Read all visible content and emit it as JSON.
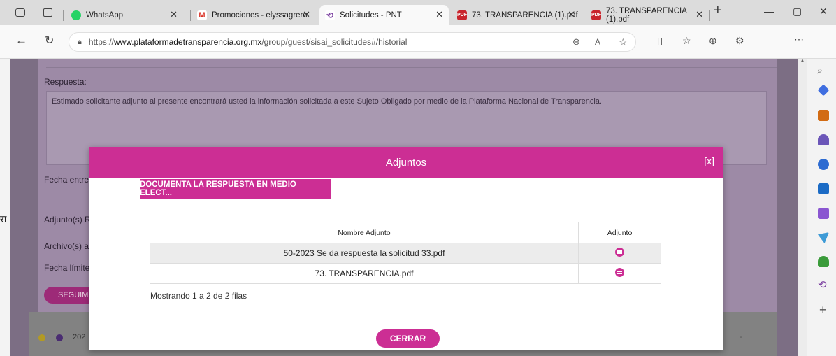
{
  "browser": {
    "tabs": [
      {
        "label": "WhatsApp"
      },
      {
        "label": "Promociones - elyssagrero"
      },
      {
        "label": "Solicitudes - PNT"
      },
      {
        "label": "73. TRANSPARENCIA (1).pdf"
      },
      {
        "label": "73. TRANSPARENCIA (1).pdf"
      }
    ],
    "url_prefix": "https://",
    "url_domain": "www.plataformadetransparencia.org.mx",
    "url_path": "/group/guest/sisai_solicitudes#/historial"
  },
  "background": {
    "respuesta_label": "Respuesta:",
    "respuesta_text": "Estimado solicitante adjunto al presente encontrará usted la información solicitada a este Sujeto Obligado por medio de la Plataforma Nacional de Transparencia.",
    "fecha_entrega_label": "Fecha entre",
    "adjuntos_label": "Adjunto(s) R",
    "archivos_label": "Archivo(s) a",
    "fecha_limite_label": "Fecha límite",
    "seguimiento_label": "SEGUIM",
    "row_year": "202"
  },
  "modal": {
    "title": "Adjuntos",
    "close": "[x]",
    "doc_button": "DOCUMENTA LA RESPUESTA EN MEDIO ELECT...",
    "table": {
      "headers": [
        "Nombre Adjunto",
        "Adjunto"
      ],
      "rows": [
        {
          "name": "50-2023 Se da respuesta la solicitud 33.pdf"
        },
        {
          "name": "73. TRANSPARENCIA.pdf"
        }
      ]
    },
    "showing": "Mostrando 1 a 2 de 2 filas",
    "cerrar": "CERRAR"
  },
  "colors": {
    "accent": "#cc2e94"
  }
}
